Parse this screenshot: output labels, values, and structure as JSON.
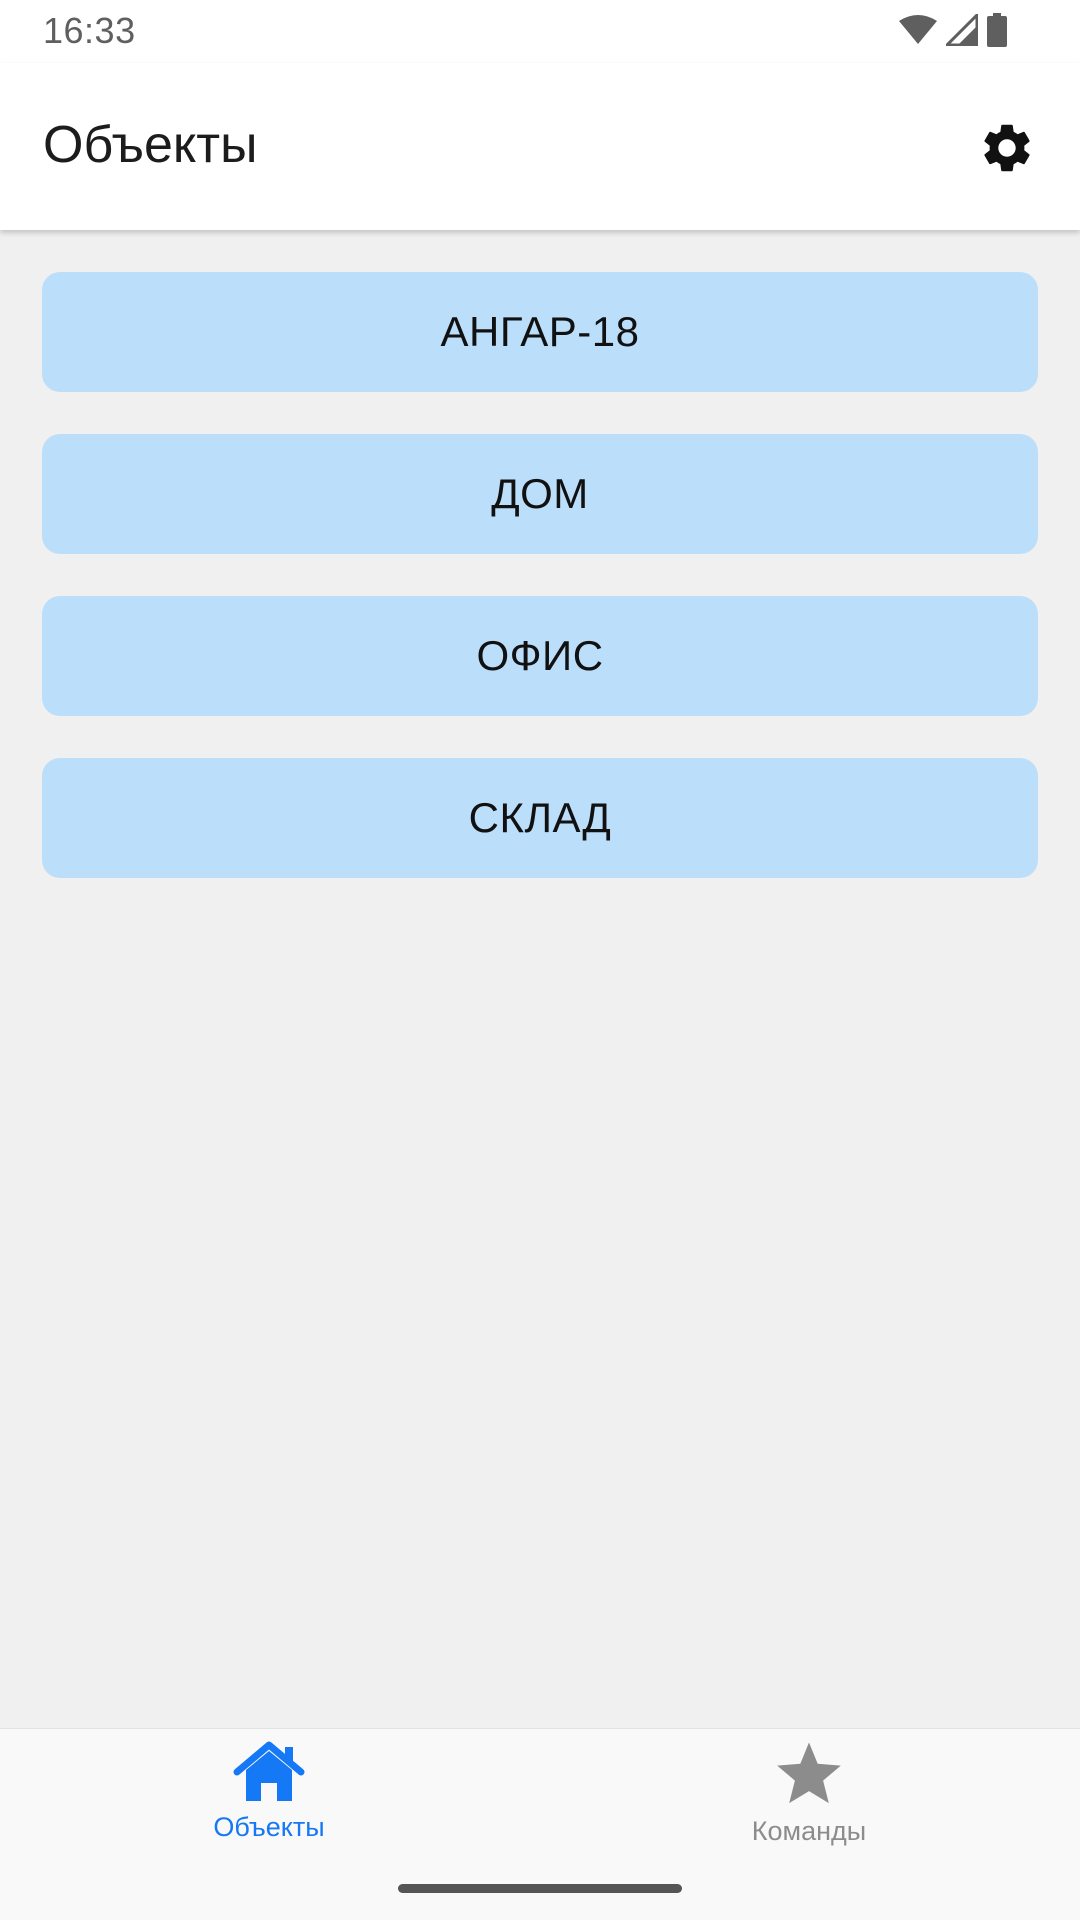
{
  "status_bar": {
    "time": "16:33",
    "icons": [
      "wifi-icon",
      "signal-icon",
      "battery-icon"
    ]
  },
  "app_bar": {
    "title": "Объекты",
    "settings_icon": "gear-icon"
  },
  "objects": [
    {
      "label": "АНГАР-18"
    },
    {
      "label": "ДОМ"
    },
    {
      "label": "ОФИС"
    },
    {
      "label": "СКЛАД"
    }
  ],
  "bottom_nav": {
    "tabs": [
      {
        "label": "Объекты",
        "icon": "home-icon",
        "active": true
      },
      {
        "label": "Команды",
        "icon": "star-icon",
        "active": false
      }
    ]
  },
  "colors": {
    "accent": "#1578f5",
    "item_background": "#bbdefa",
    "inactive_tab": "#8c8c8c",
    "page_background": "#f0f0f0"
  }
}
